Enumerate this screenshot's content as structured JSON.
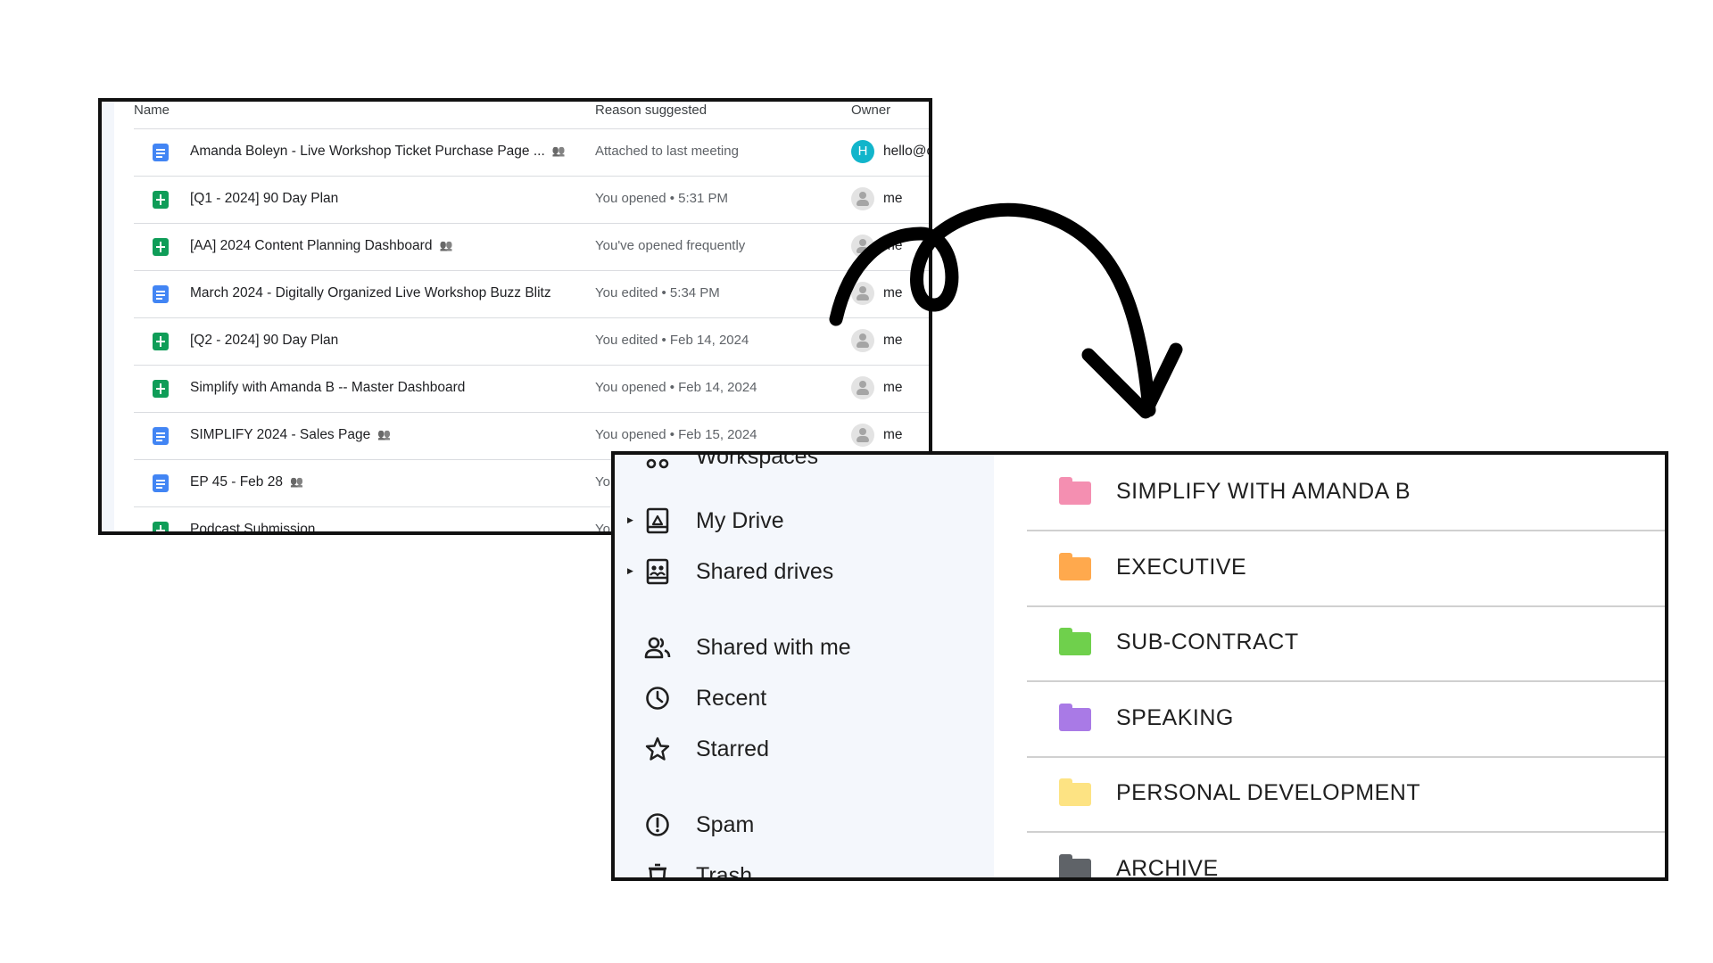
{
  "suggested": {
    "columns": {
      "name": "Name",
      "reason": "Reason suggested",
      "owner": "Owner"
    },
    "rows": [
      {
        "type": "doc",
        "name": "Amanda Boleyn - Live Workshop Ticket Purchase Page ...",
        "shared": true,
        "reason": "Attached to last meeting",
        "owner_initial": "H",
        "owner": "hello@c"
      },
      {
        "type": "sheet",
        "name": "[Q1 - 2024] 90 Day Plan",
        "shared": false,
        "reason": "You opened • 5:31 PM",
        "owner": "me"
      },
      {
        "type": "sheet",
        "name": "[AA] 2024 Content Planning Dashboard",
        "shared": true,
        "reason": "You've opened frequently",
        "owner": "me"
      },
      {
        "type": "doc",
        "name": "March 2024 - Digitally Organized Live Workshop Buzz Blitz",
        "shared": false,
        "reason": "You edited • 5:34 PM",
        "owner": "me"
      },
      {
        "type": "sheet",
        "name": "[Q2 - 2024] 90 Day Plan",
        "shared": false,
        "reason": "You edited • Feb 14, 2024",
        "owner": "me"
      },
      {
        "type": "sheet",
        "name": "Simplify with Amanda B -- Master Dashboard",
        "shared": false,
        "reason": "You opened • Feb 14, 2024",
        "owner": "me"
      },
      {
        "type": "doc",
        "name": "SIMPLIFY 2024 - Sales Page",
        "shared": true,
        "reason": "You opened • Feb 15, 2024",
        "owner": "me"
      },
      {
        "type": "doc",
        "name": "EP 45 - Feb 28",
        "shared": true,
        "reason": "Yo",
        "owner": ""
      },
      {
        "type": "sheet",
        "name": "Podcast Submission",
        "shared": false,
        "reason": "Yo",
        "owner": ""
      }
    ]
  },
  "drive": {
    "nav": [
      {
        "label": "Workspaces",
        "icon": "workspaces-icon",
        "caret": false
      },
      {
        "label": "My Drive",
        "icon": "my-drive-icon",
        "caret": true
      },
      {
        "label": "Shared drives",
        "icon": "shared-drives-icon",
        "caret": true
      },
      {
        "label": "Shared with me",
        "icon": "shared-with-me-icon",
        "caret": false
      },
      {
        "label": "Recent",
        "icon": "clock-icon",
        "caret": false
      },
      {
        "label": "Starred",
        "icon": "star-icon",
        "caret": false
      },
      {
        "label": "Spam",
        "icon": "spam-icon",
        "caret": false
      },
      {
        "label": "Trash",
        "icon": "trash-icon",
        "caret": false
      }
    ],
    "folders": [
      {
        "label": "SIMPLIFY WITH AMANDA B",
        "color": "#f48fb1"
      },
      {
        "label": "EXECUTIVE",
        "color": "#ffa94d"
      },
      {
        "label": "SUB-CONTRACT",
        "color": "#6fd04c"
      },
      {
        "label": "SPEAKING",
        "color": "#a97ae6"
      },
      {
        "label": "PERSONAL DEVELOPMENT",
        "color": "#fde383"
      },
      {
        "label": "ARCHIVE",
        "color": "#5f6368"
      }
    ]
  },
  "colors": {
    "border": "#111111",
    "arrow": "#000000",
    "sidebar_bg": "#f4f7fc"
  }
}
